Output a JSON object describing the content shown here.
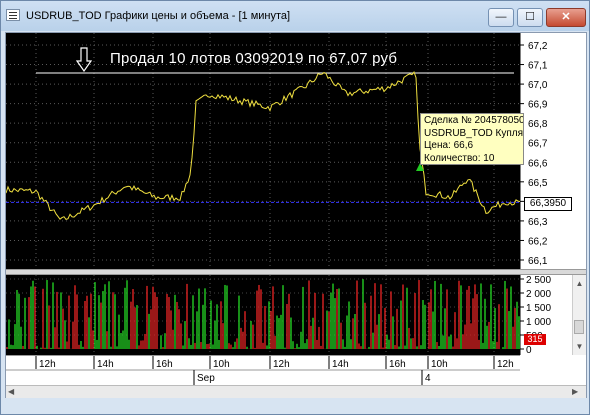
{
  "window": {
    "title": "USDRUB_TOD Графики цены и объема - [1 минута]",
    "controls": {
      "minimize": "—",
      "maximize": "☐",
      "close": "✕"
    }
  },
  "chart": {
    "headline": "Продал 10 лотов 03092019  по 67,07 руб",
    "price_ticks": [
      "67,2",
      "67,1",
      "67,0",
      "66,9",
      "66,8",
      "66,7",
      "66,6",
      "66,5",
      "66,4",
      "66,3",
      "66,2",
      "66,1"
    ],
    "last_price": "66,3950",
    "deal_tooltip": {
      "line1": "Сделка № 204578050",
      "line2": "USDRUB_TOD Купля",
      "line3": "Цена: 66,6",
      "line4": "Количество: 10"
    },
    "volume_ticks": [
      "2 500",
      "2 000",
      "1 500",
      "1 000",
      "500",
      "0"
    ],
    "volume_last": "315",
    "time_ticks": [
      "12h",
      "14h",
      "16h",
      "10h",
      "12h",
      "14h",
      "16h",
      "10h",
      "12h"
    ],
    "date_labels": [
      "Sep",
      "4"
    ],
    "colors": {
      "price_line": "#f0e040",
      "volume_up": "#22cc22",
      "volume_down": "#dd2222",
      "last_price_line": "#3333ff",
      "buy_marker": "#22cc22"
    }
  },
  "chart_data": {
    "type": "line",
    "x": [
      "12h",
      "14h",
      "16h",
      "10h",
      "12h",
      "14h",
      "16h",
      "10h",
      "12h"
    ],
    "series": [
      {
        "values": [
          66.46,
          66.38,
          66.4,
          66.8,
          66.88,
          66.94,
          67.05,
          66.9,
          66.43
        ]
      }
    ],
    "ylim": [
      66.1,
      67.2
    ],
    "grid": true
  }
}
